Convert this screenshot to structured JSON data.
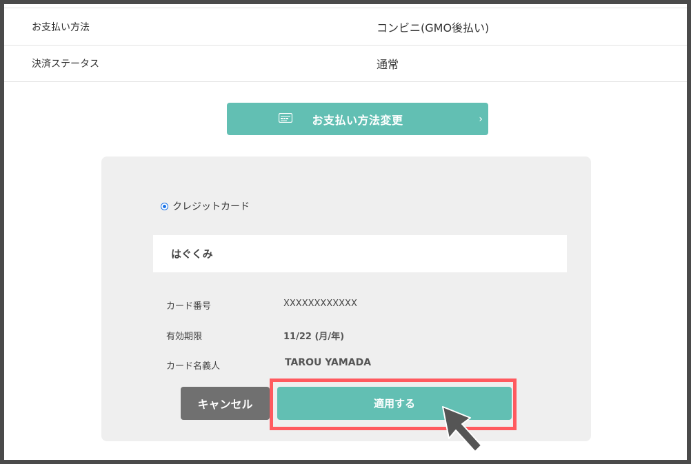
{
  "payment_info": {
    "rows": [
      {
        "label": "お支払い方法",
        "value": "コンビニ(GMO後払い)"
      },
      {
        "label": "決済ステータス",
        "value": "通常"
      }
    ]
  },
  "change_button": {
    "label": "お支払い方法変更",
    "icon": "credit-card-icon"
  },
  "panel": {
    "radio_label": "クレジットカード",
    "card_name": "はぐくみ",
    "details": [
      {
        "label": "カード番号",
        "value": "XXXXXXXXXXXX"
      },
      {
        "label": "有効期限",
        "value": "11/22 (月/年)"
      },
      {
        "label": "カード名義人",
        "value": "TAROU YAMADA"
      }
    ],
    "cancel_label": "キャンセル",
    "apply_label": "適用する"
  },
  "colors": {
    "accent": "#62bfb3",
    "cancel": "#707070",
    "highlight": "#ff5a5f",
    "frame": "#4a4a4a"
  }
}
